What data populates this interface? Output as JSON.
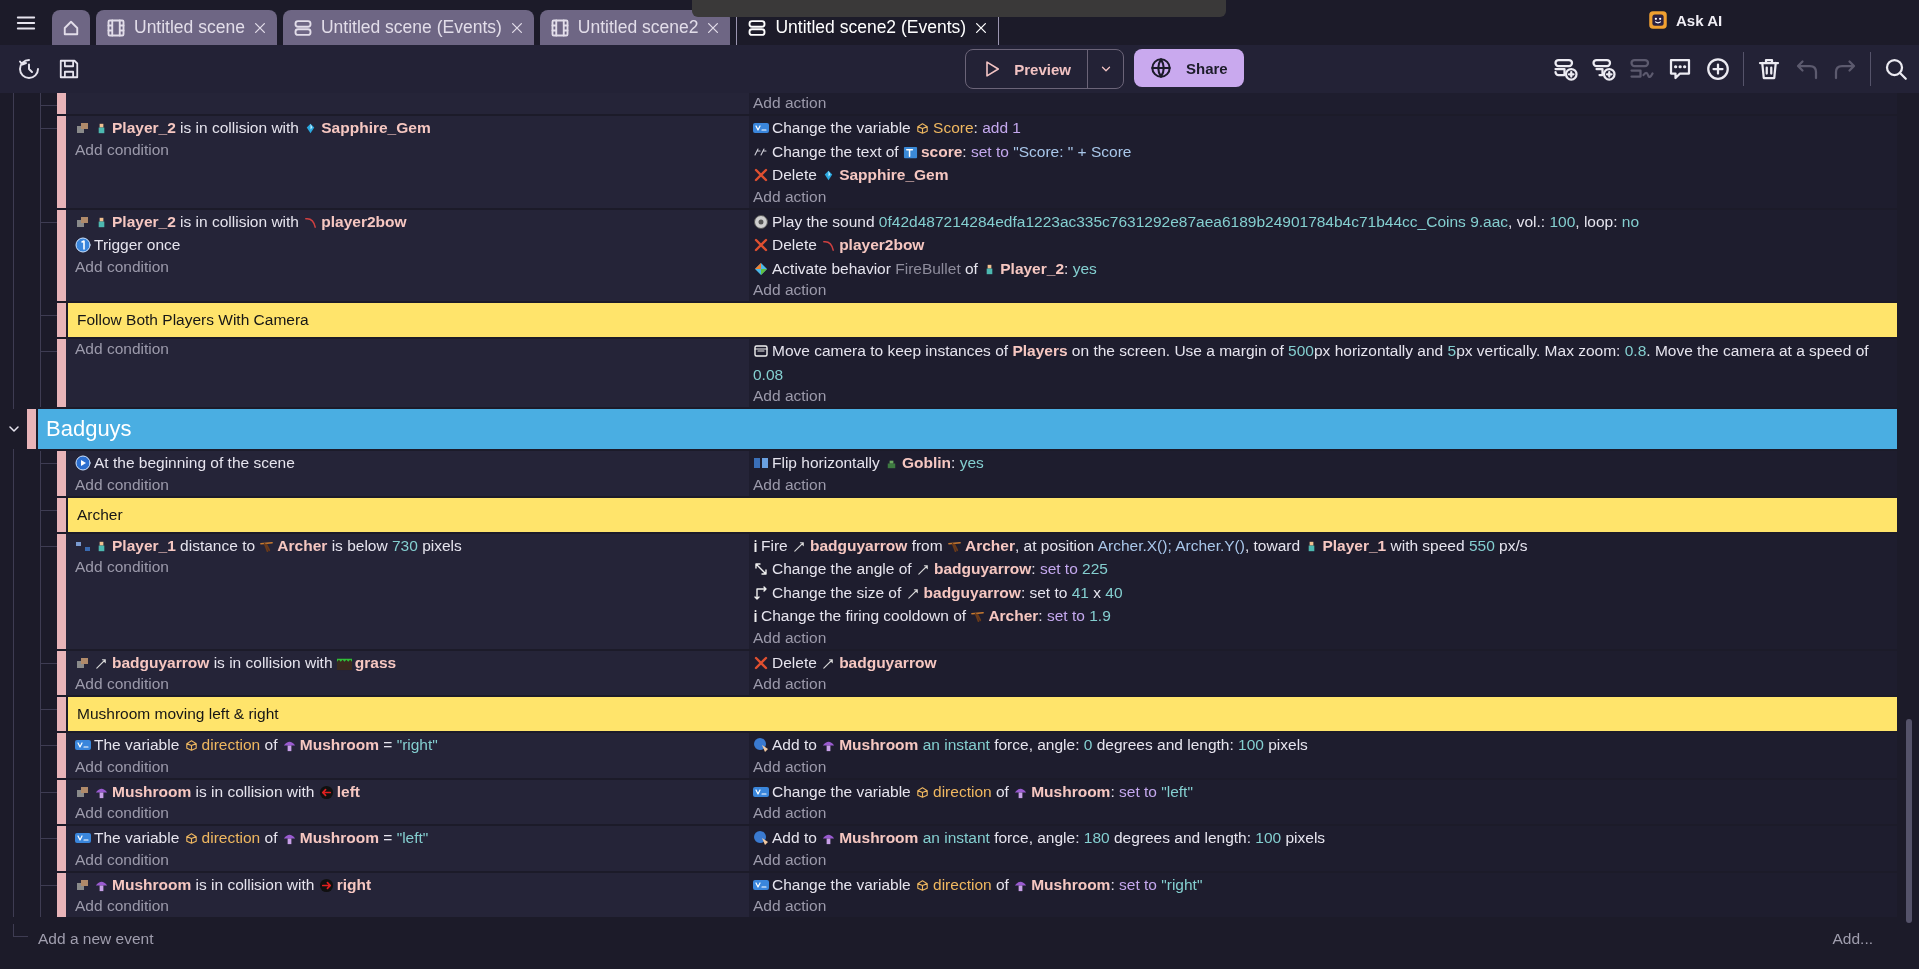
{
  "menu_button": {
    "kind": "menu"
  },
  "tabs": [
    {
      "kind": "home",
      "selected": false
    },
    {
      "kind": "scene",
      "label": "Untitled scene",
      "selected": false
    },
    {
      "kind": "events",
      "label": "Untitled scene (Events)",
      "selected": false
    },
    {
      "kind": "scene",
      "label": "Untitled scene2",
      "selected": false
    },
    {
      "kind": "events",
      "label": "Untitled scene2 (Events)",
      "selected": true
    }
  ],
  "ask_ai": {
    "label": "Ask AI"
  },
  "toolbar_left": [
    {
      "kind": "history"
    },
    {
      "kind": "save"
    }
  ],
  "preview_button": {
    "label": "Preview"
  },
  "share_button": {
    "label": "Share"
  },
  "toolbar_right": [
    {
      "kind": "add-event",
      "disabled": false
    },
    {
      "kind": "add-subevent",
      "disabled": false
    },
    {
      "kind": "add-else",
      "disabled": true
    },
    {
      "kind": "add-comment",
      "disabled": false
    },
    {
      "kind": "add-other",
      "disabled": false
    },
    {
      "kind": "separator"
    },
    {
      "kind": "delete",
      "disabled": false
    },
    {
      "kind": "undo",
      "disabled": true
    },
    {
      "kind": "redo",
      "disabled": true
    },
    {
      "kind": "separator"
    },
    {
      "kind": "search",
      "disabled": false
    }
  ],
  "events": [
    {
      "kind": "group",
      "children": [
        {
          "kind": "event",
          "add_action": "Add action"
        },
        {
          "kind": "event",
          "conditions": [
            {
              "kind": "collision",
              "parts": [
                {
                  "kind": "player"
                },
                {
                  "text": "Player_2",
                  "kind": "obj"
                },
                {
                  "text": " is in collision with ",
                  "kind": "plain"
                },
                {
                  "kind": "gem"
                },
                {
                  "text": "Sapphire_Gem",
                  "kind": "obj"
                }
              ]
            }
          ],
          "add_condition": "Add condition",
          "actions": [
            {
              "kind": "variable",
              "parts": [
                {
                  "text": "Change the variable ",
                  "kind": "plain"
                },
                {
                  "kind": "structure"
                },
                {
                  "text": "Score",
                  "kind": "var"
                },
                {
                  "text": ": ",
                  "kind": "plain"
                },
                {
                  "text": "add 1",
                  "kind": "op"
                }
              ]
            },
            {
              "kind": "text",
              "parts": [
                {
                  "text": "Change the text of ",
                  "kind": "plain"
                },
                {
                  "kind": "text-object"
                },
                {
                  "text": "score",
                  "kind": "obj"
                },
                {
                  "text": ": ",
                  "kind": "plain"
                },
                {
                  "text": "set to ",
                  "kind": "op"
                },
                {
                  "text": "\"Score: \" + Score",
                  "kind": "expr"
                }
              ]
            },
            {
              "kind": "delete",
              "parts": [
                {
                  "text": "Delete ",
                  "kind": "plain"
                },
                {
                  "kind": "gem"
                },
                {
                  "text": "Sapphire_Gem",
                  "kind": "obj"
                }
              ]
            }
          ],
          "add_action": "Add action"
        },
        {
          "kind": "event",
          "conditions": [
            {
              "kind": "collision",
              "parts": [
                {
                  "kind": "player"
                },
                {
                  "text": "Player_2",
                  "kind": "obj"
                },
                {
                  "text": " is in collision with ",
                  "kind": "plain"
                },
                {
                  "kind": "bow"
                },
                {
                  "text": "player2bow",
                  "kind": "obj"
                }
              ]
            },
            {
              "kind": "trigger",
              "parts": [
                {
                  "text": "Trigger once",
                  "kind": "plain"
                }
              ]
            }
          ],
          "add_condition": "Add condition",
          "actions": [
            {
              "kind": "sound",
              "parts": [
                {
                  "text": "Play the sound ",
                  "kind": "plain"
                },
                {
                  "text": "0f42d487214284edfa1223ac335c7631292e87aea6189b24901784b4c71b44cc_Coins 9.aac",
                  "kind": "num"
                },
                {
                  "text": ", vol.: ",
                  "kind": "plain"
                },
                {
                  "text": "100",
                  "kind": "num"
                },
                {
                  "text": ", loop: ",
                  "kind": "plain"
                },
                {
                  "text": "no",
                  "kind": "num"
                }
              ]
            },
            {
              "kind": "delete",
              "parts": [
                {
                  "text": "Delete ",
                  "kind": "plain"
                },
                {
                  "kind": "bow"
                },
                {
                  "text": "player2bow",
                  "kind": "obj"
                }
              ]
            },
            {
              "kind": "behavior",
              "parts": [
                {
                  "text": "Activate behavior ",
                  "kind": "plain"
                },
                {
                  "text": "FireBullet",
                  "kind": "muted"
                },
                {
                  "text": " of ",
                  "kind": "plain"
                },
                {
                  "kind": "player"
                },
                {
                  "text": "Player_2",
                  "kind": "obj"
                },
                {
                  "text": ": ",
                  "kind": "plain"
                },
                {
                  "text": "yes",
                  "kind": "num"
                }
              ]
            }
          ],
          "add_action": "Add action"
        },
        {
          "kind": "comment",
          "text": "Follow Both Players With Camera"
        },
        {
          "kind": "event",
          "add_condition": "Add condition",
          "actions": [
            {
              "kind": "camera",
              "parts": [
                {
                  "text": "Move camera to keep instances of ",
                  "kind": "plain"
                },
                {
                  "text": "Players",
                  "kind": "obj"
                },
                {
                  "text": " on the screen. Use a margin of ",
                  "kind": "plain"
                },
                {
                  "text": "500",
                  "kind": "num"
                },
                {
                  "text": "px horizontally and ",
                  "kind": "plain"
                },
                {
                  "text": "5",
                  "kind": "num"
                },
                {
                  "text": "px vertically. Max zoom: ",
                  "kind": "plain"
                },
                {
                  "text": "0.8",
                  "kind": "num"
                },
                {
                  "text": ". Move the camera at a speed of ",
                  "kind": "plain"
                },
                {
                  "text": "0.08",
                  "kind": "num"
                }
              ]
            }
          ],
          "add_action": "Add action"
        }
      ]
    },
    {
      "kind": "group",
      "title": "Badguys",
      "expanded": true,
      "children": [
        {
          "kind": "event",
          "conditions": [
            {
              "kind": "start",
              "parts": [
                {
                  "text": "At the beginning of the scene",
                  "kind": "plain"
                }
              ]
            }
          ],
          "add_condition": "Add condition",
          "actions": [
            {
              "kind": "flip",
              "parts": [
                {
                  "text": "Flip horizontally ",
                  "kind": "plain"
                },
                {
                  "kind": "goblin"
                },
                {
                  "text": "Goblin",
                  "kind": "obj"
                },
                {
                  "text": ": ",
                  "kind": "plain"
                },
                {
                  "text": "yes",
                  "kind": "num"
                }
              ]
            }
          ],
          "add_action": "Add action"
        },
        {
          "kind": "comment",
          "text": "Archer"
        },
        {
          "kind": "event",
          "conditions": [
            {
              "kind": "distance",
              "parts": [
                {
                  "kind": "player"
                },
                {
                  "text": "Player_1",
                  "kind": "obj"
                },
                {
                  "text": " distance to ",
                  "kind": "plain"
                },
                {
                  "kind": "archer"
                },
                {
                  "text": "Archer",
                  "kind": "obj"
                },
                {
                  "text": " is below ",
                  "kind": "plain"
                },
                {
                  "text": "730",
                  "kind": "num"
                },
                {
                  "text": " pixels",
                  "kind": "plain"
                }
              ]
            }
          ],
          "add_condition": "Add condition",
          "actions": [
            {
              "kind": "fire",
              "parts": [
                {
                  "text": "Fire ",
                  "kind": "plain"
                },
                {
                  "kind": "arrow"
                },
                {
                  "text": "badguyarrow",
                  "kind": "obj"
                },
                {
                  "text": " from ",
                  "kind": "plain"
                },
                {
                  "kind": "archer"
                },
                {
                  "text": "Archer",
                  "kind": "obj"
                },
                {
                  "text": ", at position ",
                  "kind": "plain"
                },
                {
                  "text": "Archer.X(); Archer.Y()",
                  "kind": "expr"
                },
                {
                  "text": ", toward ",
                  "kind": "plain"
                },
                {
                  "kind": "player"
                },
                {
                  "text": "Player_1",
                  "kind": "obj"
                },
                {
                  "text": " with speed ",
                  "kind": "plain"
                },
                {
                  "text": "550",
                  "kind": "num"
                },
                {
                  "text": " px/s",
                  "kind": "plain"
                }
              ]
            },
            {
              "kind": "angle",
              "parts": [
                {
                  "text": "Change the angle of ",
                  "kind": "plain"
                },
                {
                  "kind": "arrow"
                },
                {
                  "text": "badguyarrow",
                  "kind": "obj"
                },
                {
                  "text": ": ",
                  "kind": "plain"
                },
                {
                  "text": "set to ",
                  "kind": "op"
                },
                {
                  "text": "225",
                  "kind": "num"
                }
              ]
            },
            {
              "kind": "size",
              "parts": [
                {
                  "text": "Change the size of ",
                  "kind": "plain"
                },
                {
                  "kind": "arrow"
                },
                {
                  "text": "badguyarrow",
                  "kind": "obj"
                },
                {
                  "text": ": set to ",
                  "kind": "plain"
                },
                {
                  "text": "41",
                  "kind": "num"
                },
                {
                  "text": " x ",
                  "kind": "plain"
                },
                {
                  "text": "40",
                  "kind": "num"
                }
              ]
            },
            {
              "kind": "fire",
              "parts": [
                {
                  "text": "Change the firing cooldown of ",
                  "kind": "plain"
                },
                {
                  "kind": "archer"
                },
                {
                  "text": "Archer",
                  "kind": "obj"
                },
                {
                  "text": ": ",
                  "kind": "plain"
                },
                {
                  "text": "set to ",
                  "kind": "op"
                },
                {
                  "text": "1.9",
                  "kind": "num"
                }
              ]
            }
          ],
          "add_action": "Add action"
        },
        {
          "kind": "event",
          "conditions": [
            {
              "kind": "collision",
              "parts": [
                {
                  "kind": "arrow"
                },
                {
                  "text": "badguyarrow",
                  "kind": "obj"
                },
                {
                  "text": " is in collision with ",
                  "kind": "plain"
                },
                {
                  "kind": "grass"
                },
                {
                  "text": "grass",
                  "kind": "obj"
                }
              ]
            }
          ],
          "add_condition": "Add condition",
          "actions": [
            {
              "kind": "delete",
              "parts": [
                {
                  "text": "Delete ",
                  "kind": "plain"
                },
                {
                  "kind": "arrow"
                },
                {
                  "text": "badguyarrow",
                  "kind": "obj"
                }
              ]
            }
          ],
          "add_action": "Add action"
        },
        {
          "kind": "comment",
          "text": "Mushroom moving left & right"
        },
        {
          "kind": "event",
          "conditions": [
            {
              "kind": "variable",
              "parts": [
                {
                  "text": "The variable ",
                  "kind": "plain"
                },
                {
                  "kind": "structure"
                },
                {
                  "text": "direction",
                  "kind": "var"
                },
                {
                  "text": " of ",
                  "kind": "plain"
                },
                {
                  "kind": "mushroom"
                },
                {
                  "text": "Mushroom",
                  "kind": "obj"
                },
                {
                  "text": " = ",
                  "kind": "plain"
                },
                {
                  "text": "\"right\"",
                  "kind": "num"
                }
              ]
            }
          ],
          "add_condition": "Add condition",
          "actions": [
            {
              "kind": "force",
              "parts": [
                {
                  "text": "Add to ",
                  "kind": "plain"
                },
                {
                  "kind": "mushroom"
                },
                {
                  "text": "Mushroom",
                  "kind": "obj"
                },
                {
                  "text": " an instant",
                  "kind": "num"
                },
                {
                  "text": " force, angle: ",
                  "kind": "plain"
                },
                {
                  "text": "0",
                  "kind": "num"
                },
                {
                  "text": " degrees and length: ",
                  "kind": "plain"
                },
                {
                  "text": "100",
                  "kind": "num"
                },
                {
                  "text": " pixels",
                  "kind": "plain"
                }
              ]
            }
          ],
          "add_action": "Add action"
        },
        {
          "kind": "event",
          "conditions": [
            {
              "kind": "collision",
              "parts": [
                {
                  "kind": "mushroom"
                },
                {
                  "text": "Mushroom",
                  "kind": "obj"
                },
                {
                  "text": " is in collision with ",
                  "kind": "plain"
                },
                {
                  "kind": "left"
                },
                {
                  "text": "left",
                  "kind": "obj"
                }
              ]
            }
          ],
          "add_condition": "Add condition",
          "actions": [
            {
              "kind": "variable",
              "parts": [
                {
                  "text": "Change the variable ",
                  "kind": "plain"
                },
                {
                  "kind": "structure"
                },
                {
                  "text": "direction",
                  "kind": "var"
                },
                {
                  "text": " of ",
                  "kind": "plain"
                },
                {
                  "kind": "mushroom"
                },
                {
                  "text": "Mushroom",
                  "kind": "obj"
                },
                {
                  "text": ": ",
                  "kind": "plain"
                },
                {
                  "text": "set to ",
                  "kind": "op"
                },
                {
                  "text": "\"left\"",
                  "kind": "num"
                }
              ]
            }
          ],
          "add_action": "Add action"
        },
        {
          "kind": "event",
          "conditions": [
            {
              "kind": "variable",
              "parts": [
                {
                  "text": "The variable ",
                  "kind": "plain"
                },
                {
                  "kind": "structure"
                },
                {
                  "text": "direction",
                  "kind": "var"
                },
                {
                  "text": " of ",
                  "kind": "plain"
                },
                {
                  "kind": "mushroom"
                },
                {
                  "text": "Mushroom",
                  "kind": "obj"
                },
                {
                  "text": " = ",
                  "kind": "plain"
                },
                {
                  "text": "\"left\"",
                  "kind": "num"
                }
              ]
            }
          ],
          "add_condition": "Add condition",
          "actions": [
            {
              "kind": "force",
              "parts": [
                {
                  "text": "Add to ",
                  "kind": "plain"
                },
                {
                  "kind": "mushroom"
                },
                {
                  "text": "Mushroom",
                  "kind": "obj"
                },
                {
                  "text": " an instant",
                  "kind": "num"
                },
                {
                  "text": " force, angle: ",
                  "kind": "plain"
                },
                {
                  "text": "180",
                  "kind": "num"
                },
                {
                  "text": " degrees and length: ",
                  "kind": "plain"
                },
                {
                  "text": "100",
                  "kind": "num"
                },
                {
                  "text": " pixels",
                  "kind": "plain"
                }
              ]
            }
          ],
          "add_action": "Add action"
        },
        {
          "kind": "event",
          "conditions": [
            {
              "kind": "collision",
              "parts": [
                {
                  "kind": "mushroom"
                },
                {
                  "text": "Mushroom",
                  "kind": "obj"
                },
                {
                  "text": " is in collision with ",
                  "kind": "plain"
                },
                {
                  "kind": "right"
                },
                {
                  "text": "right",
                  "kind": "obj"
                }
              ]
            }
          ],
          "add_condition": "Add condition",
          "actions": [
            {
              "kind": "variable",
              "parts": [
                {
                  "text": "Change the variable ",
                  "kind": "plain"
                },
                {
                  "kind": "structure"
                },
                {
                  "text": "direction",
                  "kind": "var"
                },
                {
                  "text": " of ",
                  "kind": "plain"
                },
                {
                  "kind": "mushroom"
                },
                {
                  "text": "Mushroom",
                  "kind": "obj"
                },
                {
                  "text": ": ",
                  "kind": "plain"
                },
                {
                  "text": "set to ",
                  "kind": "op"
                },
                {
                  "text": "\"right\"",
                  "kind": "num"
                }
              ]
            }
          ],
          "add_action": "Add action"
        }
      ]
    }
  ],
  "add_event": "Add a new event",
  "add_more": "Add..."
}
